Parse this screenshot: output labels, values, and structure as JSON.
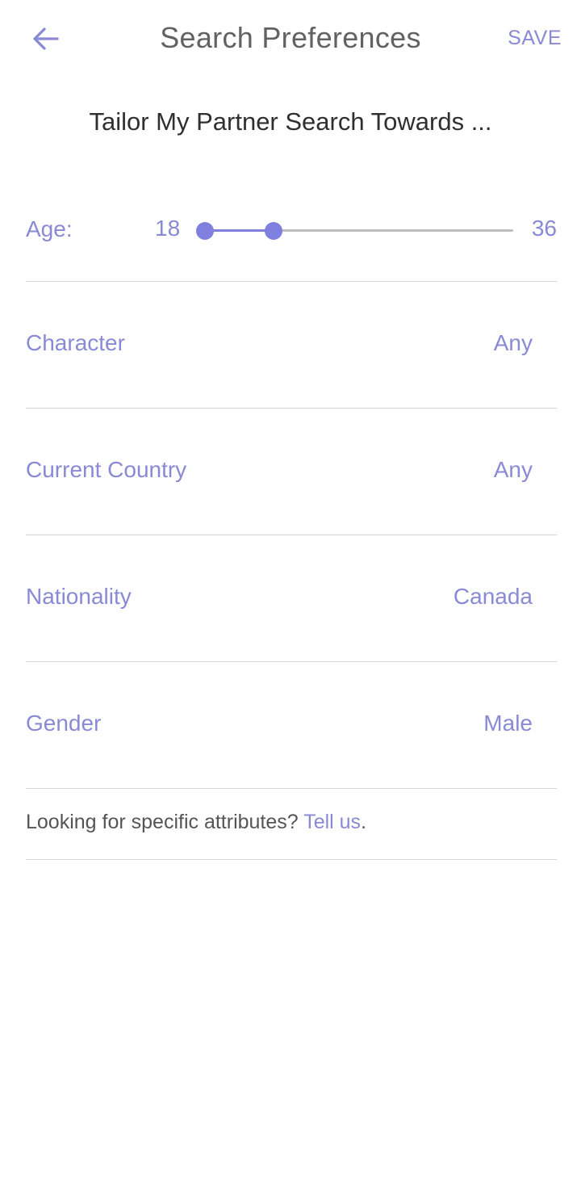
{
  "header": {
    "back_icon": "arrow-left-icon",
    "title": "Search Preferences",
    "save_label": "SAVE"
  },
  "subtitle": "Tailor My Partner Search Towards ...",
  "age": {
    "label": "Age:",
    "min_label": "18",
    "max_label": "36",
    "range_min": 18,
    "range_max": 36,
    "selected_low": 18,
    "selected_high": 22
  },
  "preferences": [
    {
      "label": "Character",
      "value": "Any"
    },
    {
      "label": "Current Country",
      "value": "Any"
    },
    {
      "label": "Nationality",
      "value": "Canada"
    },
    {
      "label": "Gender",
      "value": "Male"
    }
  ],
  "footer": {
    "text": "Looking for specific attributes? ",
    "link": "Tell us",
    "suffix": "."
  },
  "colors": {
    "accent": "#8a89d6",
    "slider": "#7f7fe0",
    "title": "#626262",
    "divider": "#d6d6d6"
  }
}
